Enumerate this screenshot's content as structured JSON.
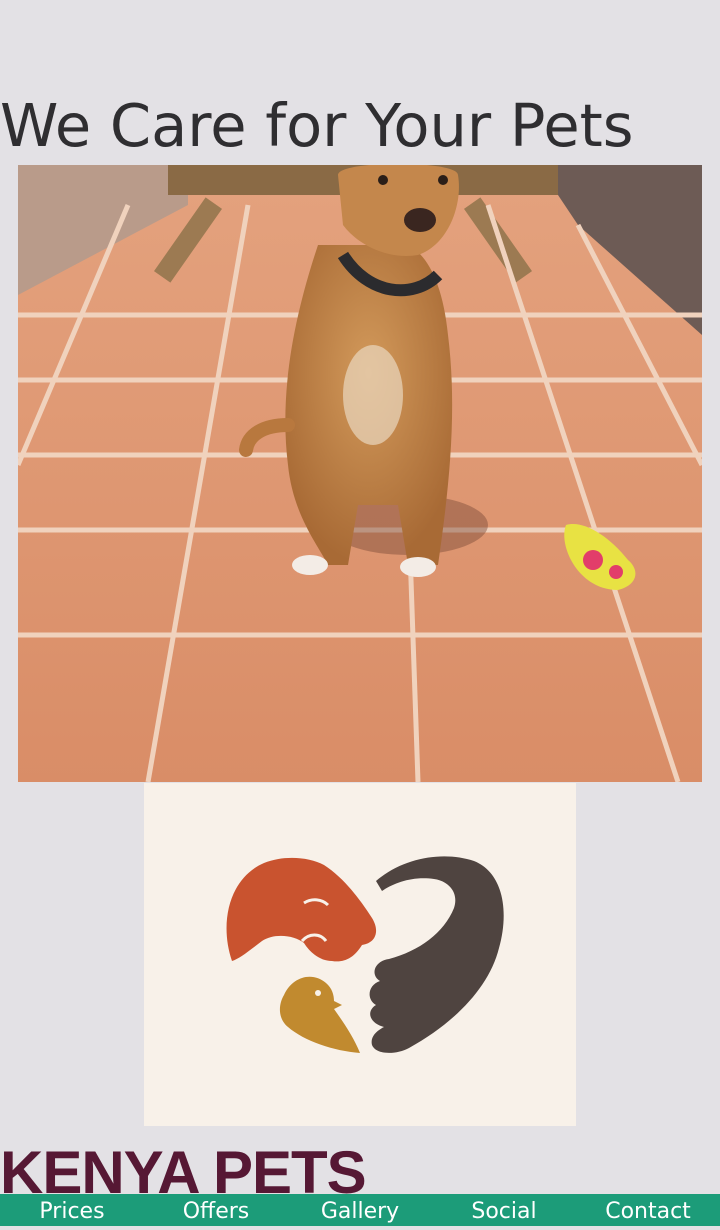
{
  "page": {
    "headline": "We Care for Your Pets",
    "brand_name": "KENYA PETS"
  },
  "hero_image": {
    "subject": "dog sitting on terracotta tiled patio with a ball"
  },
  "logo": {
    "subject": "heart formed by dog head, bird and hand",
    "colors": {
      "dog": "#c9532f",
      "hand": "#4f4440",
      "bird": "#c18a2f",
      "background": "#f8f1e9"
    }
  },
  "nav": {
    "items": [
      {
        "label": "Prices"
      },
      {
        "label": "Offers"
      },
      {
        "label": "Gallery"
      },
      {
        "label": "Social"
      },
      {
        "label": "Contact"
      }
    ],
    "background": "#1c9c79"
  }
}
